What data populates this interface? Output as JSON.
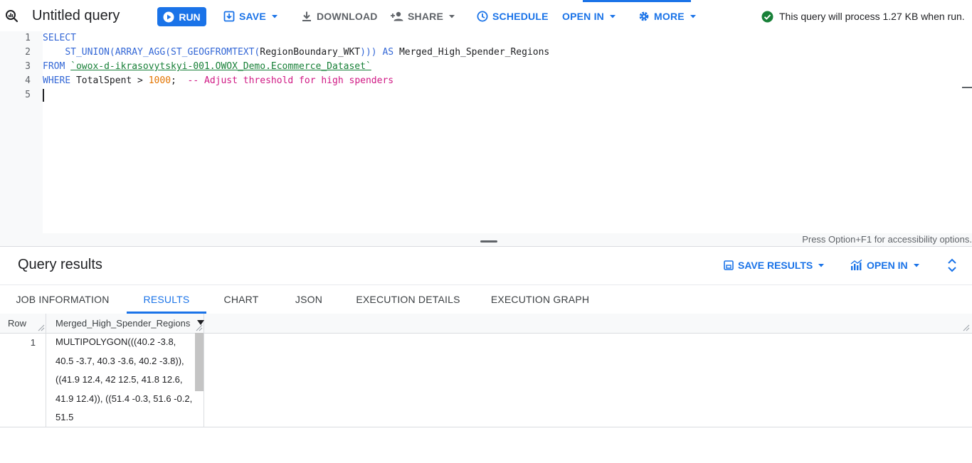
{
  "toolbar": {
    "title": "Untitled query",
    "run_label": "RUN",
    "save_label": "SAVE",
    "download_label": "DOWNLOAD",
    "share_label": "SHARE",
    "schedule_label": "SCHEDULE",
    "open_in_label": "OPEN IN",
    "more_label": "MORE",
    "process_info": "This query will process 1.27 KB when run."
  },
  "editor": {
    "line_numbers": [
      "1",
      "2",
      "3",
      "4",
      "5"
    ],
    "line1": {
      "kw": "SELECT"
    },
    "line2": {
      "fn": "ST_UNION(ARRAY_AGG(ST_GEOGFROMTEXT(",
      "col": "RegionBoundary_WKT",
      "close": ")))",
      "as": "AS",
      "alias": "Merged_High_Spender_Regions"
    },
    "line3": {
      "kw": "FROM",
      "table": "`owox-d-ikrasovytskyi-001.OWOX_Demo.Ecommerce_Dataset`"
    },
    "line4": {
      "kw": "WHERE",
      "col": "TotalSpent > ",
      "num": "1000",
      "semi": ";",
      "comment": "-- Adjust threshold for high spenders"
    },
    "a11y_hint": "Press Option+F1 for accessibility options."
  },
  "results": {
    "title": "Query results",
    "save_results_label": "SAVE RESULTS",
    "open_in_label": "OPEN IN",
    "tabs": [
      {
        "label": "JOB INFORMATION"
      },
      {
        "label": "RESULTS"
      },
      {
        "label": "CHART"
      },
      {
        "label": "JSON"
      },
      {
        "label": "EXECUTION DETAILS"
      },
      {
        "label": "EXECUTION GRAPH"
      }
    ],
    "columns": {
      "row": "Row",
      "merged": "Merged_High_Spender_Regions"
    },
    "rows": [
      {
        "row": "1",
        "value": "MULTIPOLYGON(((40.2 -3.8, 40.5 -3.7, 40.3 -3.6, 40.2 -3.8)), ((41.9 12.4, 42 12.5, 41.8 12.6, 41.9 12.4)), ((51.4 -0.3, 51.6 -0.2, 51.5"
      }
    ]
  },
  "colors": {
    "accent": "#1a73e8",
    "success": "#188038",
    "number": "#e37400",
    "comment": "#d01884"
  }
}
